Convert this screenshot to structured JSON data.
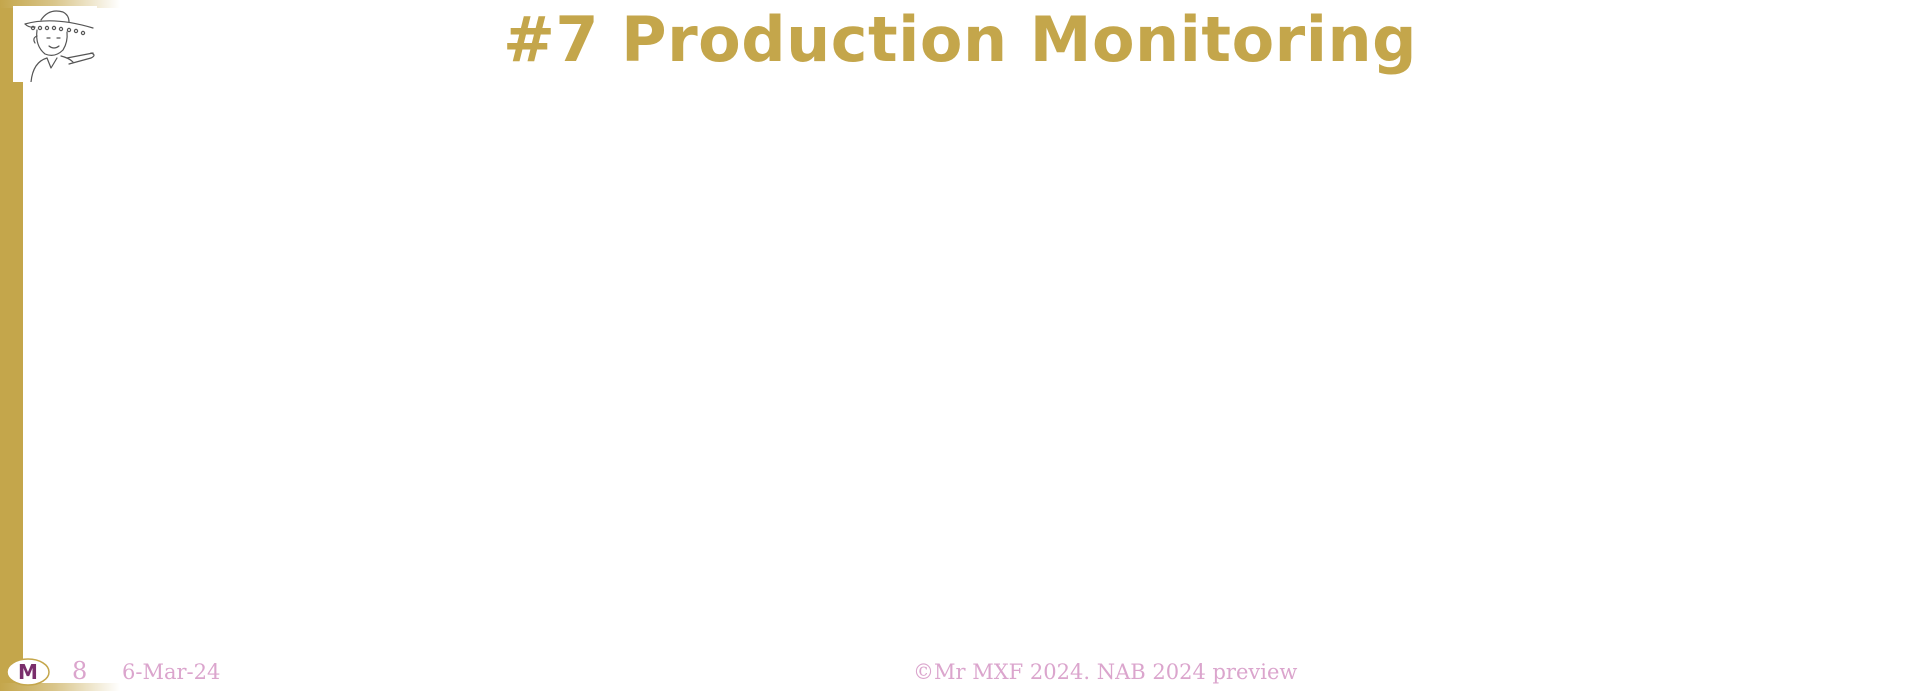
{
  "slide": {
    "title": "#7 Production Monitoring"
  },
  "footer": {
    "logo_letter": "M",
    "slide_number": "8",
    "date": "6-Mar-24",
    "copyright": "©Mr MXF 2024. NAB 2024 preview"
  },
  "colors": {
    "accent_gold": "#c4a64b",
    "footer_pink": "#dba5cd",
    "logo_purple": "#7a2e6b"
  },
  "icons": {
    "mascot": "cartoon-man-with-hat-pointing-icon",
    "logo": "mr-mxf-logo-icon"
  }
}
